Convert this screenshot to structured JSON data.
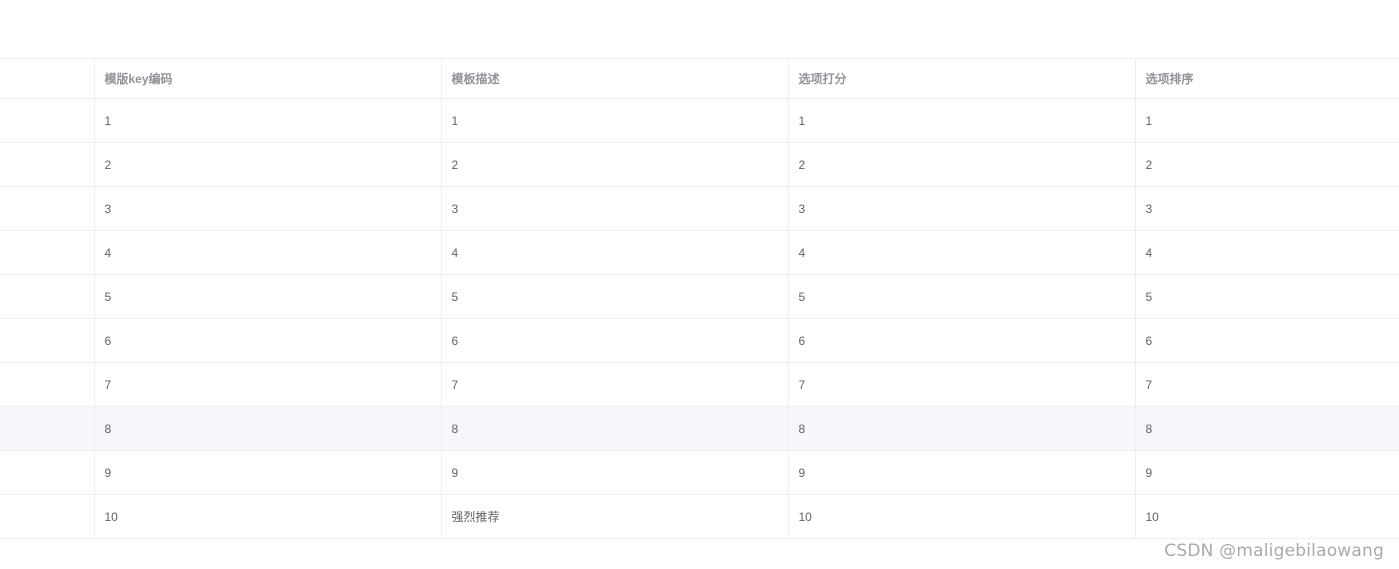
{
  "table": {
    "columns": [
      "",
      "模版key编码",
      "模板描述",
      "选项打分",
      "选项排序"
    ],
    "rows": [
      [
        "",
        "1",
        "1",
        "1",
        "1"
      ],
      [
        "",
        "2",
        "2",
        "2",
        "2"
      ],
      [
        "",
        "3",
        "3",
        "3",
        "3"
      ],
      [
        "",
        "4",
        "4",
        "4",
        "4"
      ],
      [
        "",
        "5",
        "5",
        "5",
        "5"
      ],
      [
        "",
        "6",
        "6",
        "6",
        "6"
      ],
      [
        "",
        "7",
        "7",
        "7",
        "7"
      ],
      [
        "",
        "8",
        "8",
        "8",
        "8"
      ],
      [
        "",
        "9",
        "9",
        "9",
        "9"
      ],
      [
        "",
        "10",
        "强烈推荐",
        "10",
        "10"
      ]
    ],
    "hovered_row_index": 7,
    "colors": {
      "border": "#ebeef5",
      "header_text": "#909399",
      "cell_text": "#606266",
      "hover_background": "#f5f7fa"
    }
  },
  "watermark": {
    "text": "CSDN @maligebilaowang"
  }
}
